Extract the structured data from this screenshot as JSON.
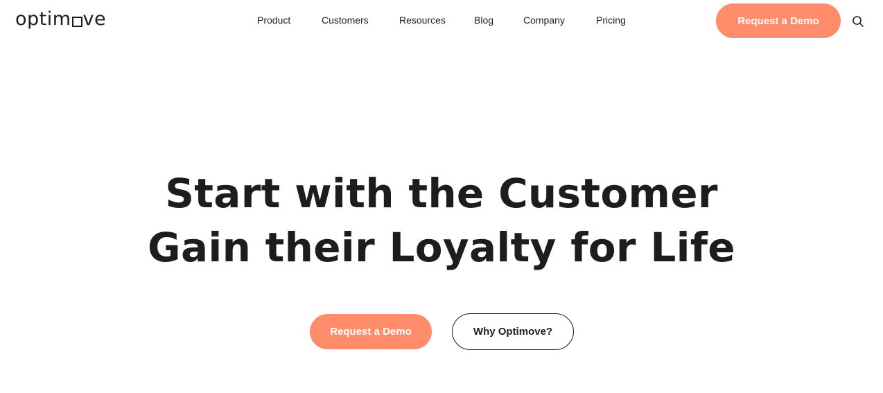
{
  "brand": {
    "logo_prefix": "optim",
    "logo_suffix": "ve",
    "accent_color": "#ff8c6b",
    "text_color": "#1d1d1f"
  },
  "nav": {
    "items": [
      {
        "label": "Product"
      },
      {
        "label": "Customers"
      },
      {
        "label": "Resources"
      },
      {
        "label": "Blog"
      },
      {
        "label": "Company"
      },
      {
        "label": "Pricing"
      }
    ],
    "cta_label": "Request a Demo",
    "search_icon": "search-icon"
  },
  "hero": {
    "title_line1": "Start with the Customer",
    "title_line2": "Gain their Loyalty for Life",
    "primary_cta": "Request a Demo",
    "secondary_cta": "Why Optimove?"
  }
}
